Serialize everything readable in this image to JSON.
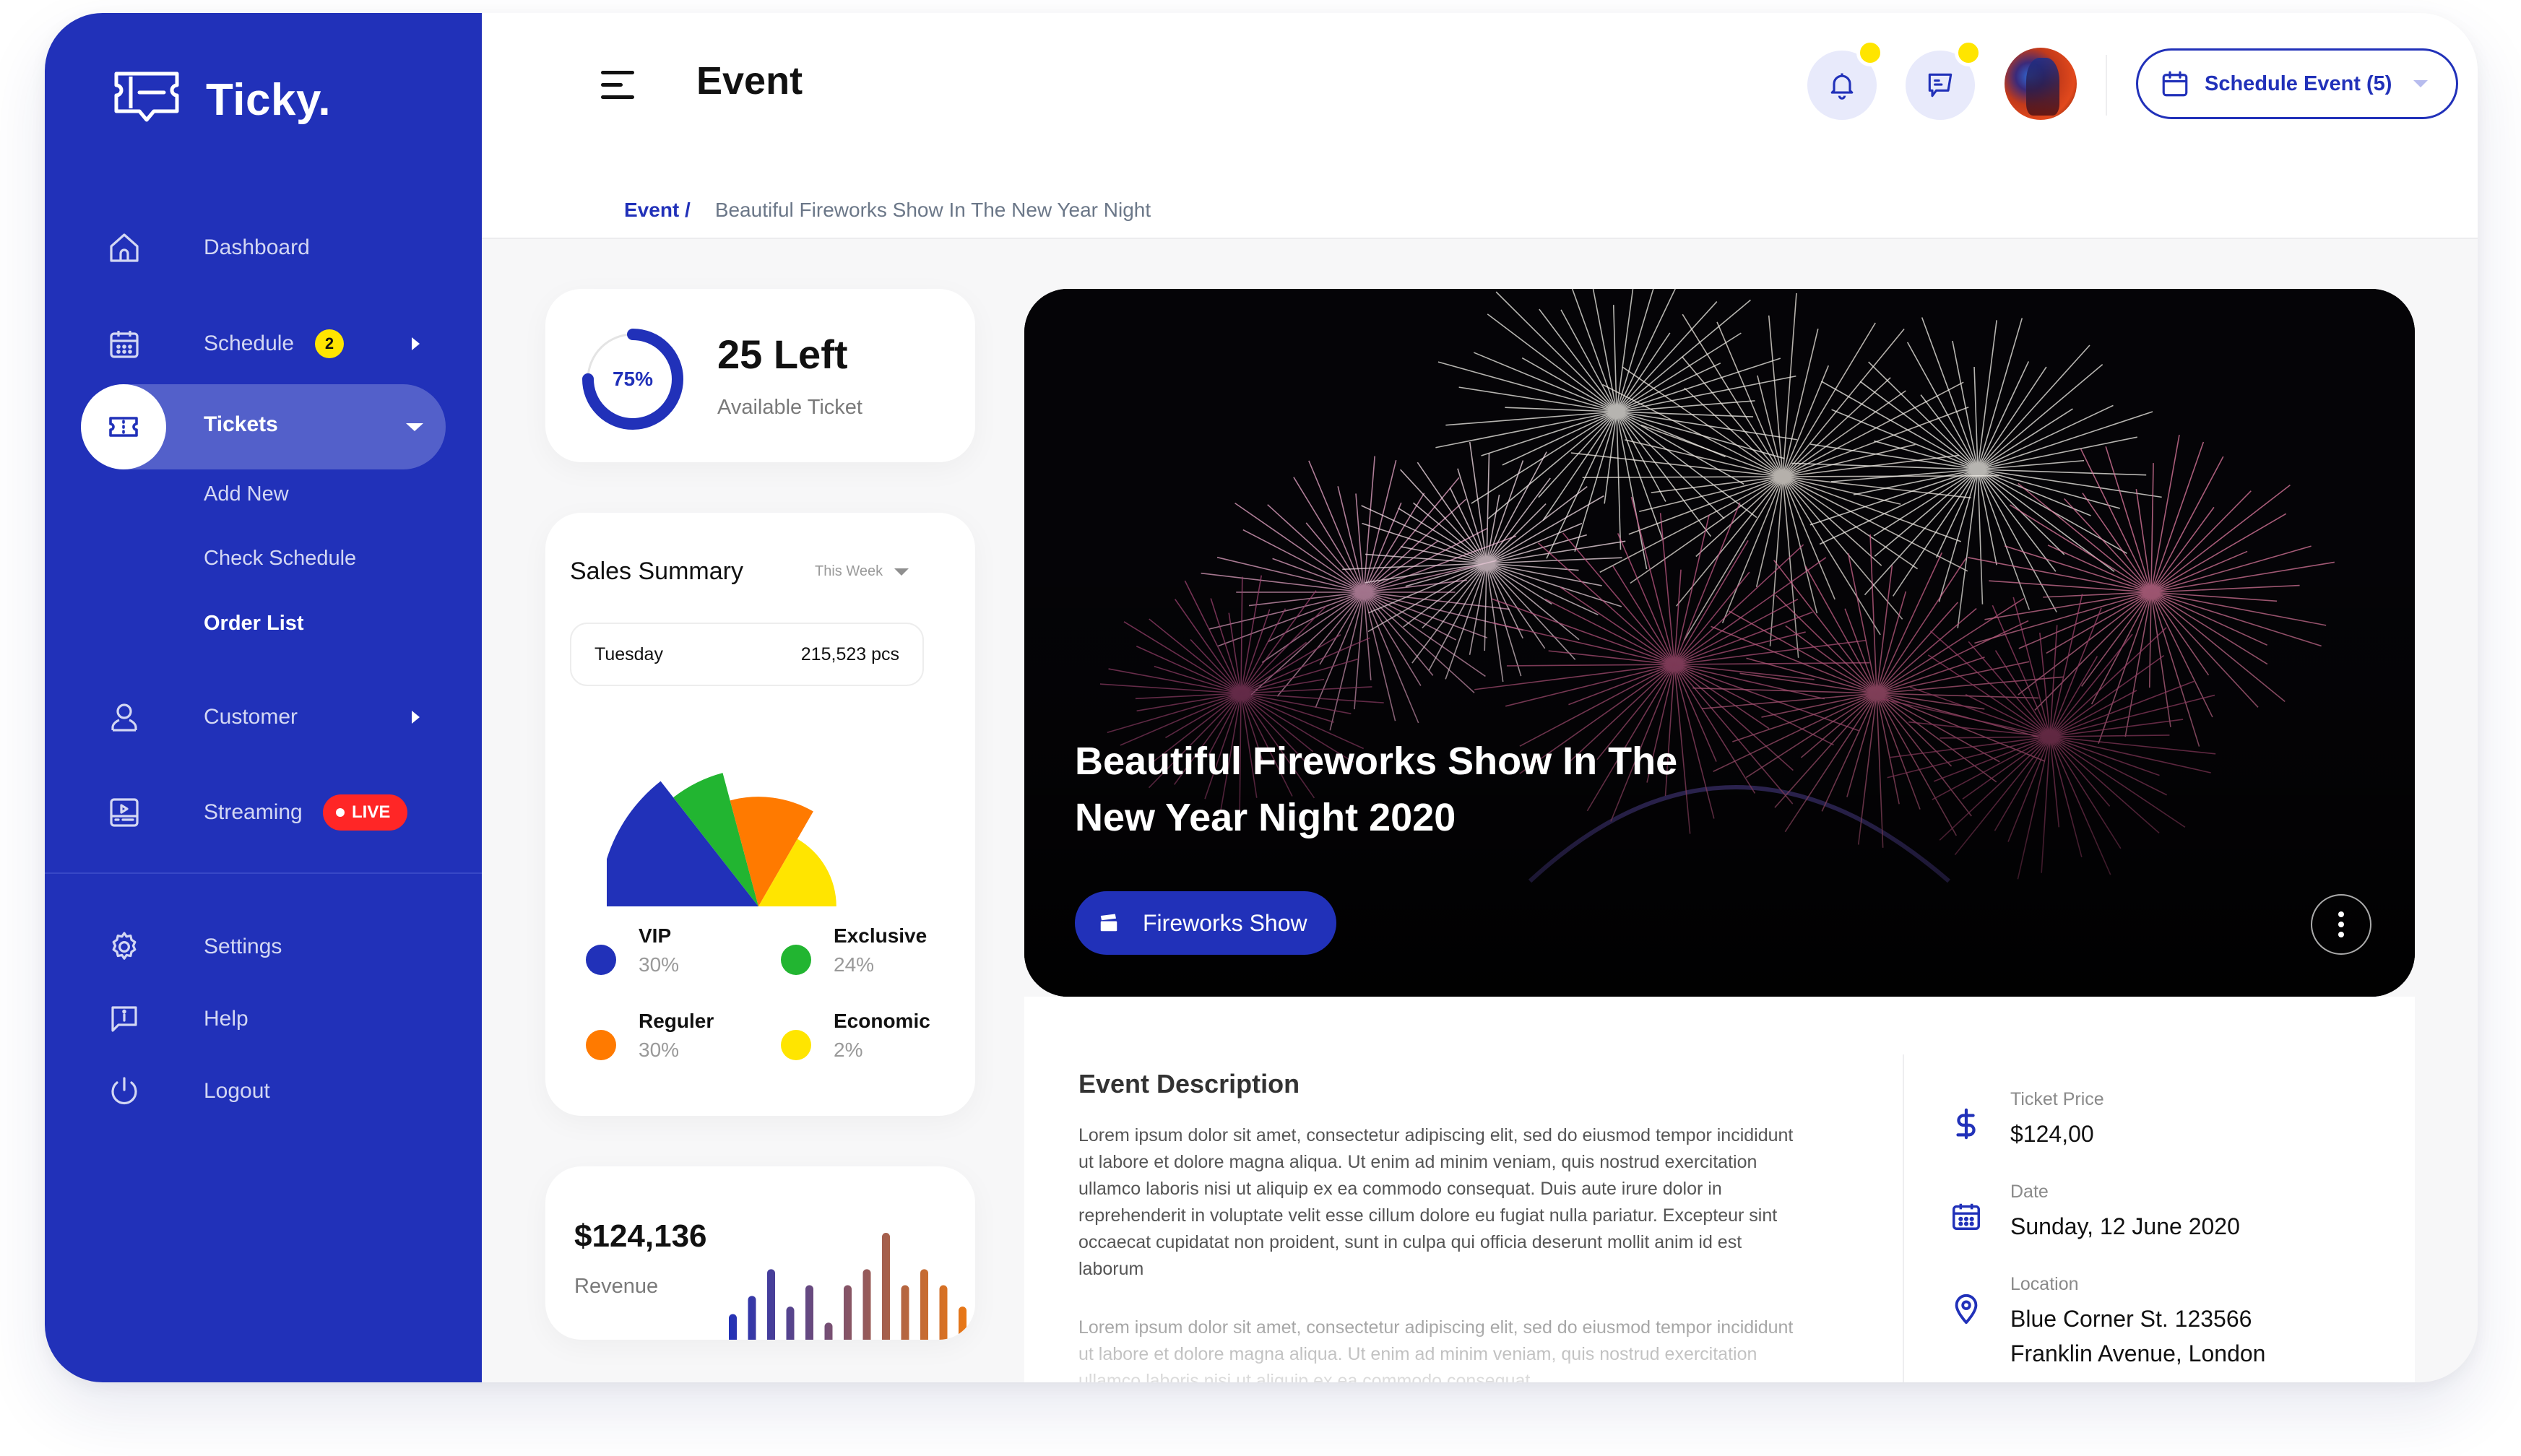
{
  "app": {
    "name": "Ticky."
  },
  "sidebar": {
    "items": [
      {
        "label": "Dashboard",
        "icon": "home-icon"
      },
      {
        "label": "Schedule",
        "icon": "calendar-icon",
        "badge": "2",
        "has_submenu": true
      },
      {
        "label": "Tickets",
        "icon": "ticket-icon",
        "active": true,
        "expanded": true,
        "children": [
          {
            "label": "Add New"
          },
          {
            "label": "Check Schedule"
          },
          {
            "label": "Order List",
            "active": true
          }
        ]
      },
      {
        "label": "Customer",
        "icon": "user-icon",
        "has_submenu": true
      },
      {
        "label": "Streaming",
        "icon": "video-icon",
        "badge": "LIVE"
      }
    ],
    "bottom_items": [
      {
        "label": "Settings",
        "icon": "gear-icon"
      },
      {
        "label": "Help",
        "icon": "help-icon"
      },
      {
        "label": "Logout",
        "icon": "power-icon"
      }
    ]
  },
  "header": {
    "title": "Event",
    "breadcrumb": {
      "root": "Event /",
      "current": "Beautiful Fireworks Show In The New Year Night"
    },
    "schedule_button": "Schedule Event (5)",
    "notifications_indicator": true,
    "messages_indicator": true
  },
  "tickets": {
    "percent": 75,
    "percent_label": "75%",
    "value": "25 Left",
    "label": "Available Ticket"
  },
  "sales_summary": {
    "title": "Sales Summary",
    "filter": "This Week",
    "row": {
      "day": "Tuesday",
      "value": "215,523 pcs"
    }
  },
  "revenue": {
    "value": "$124,136",
    "label": "Revenue"
  },
  "event": {
    "title": "Beautiful Fireworks Show In The New Year Night 2020",
    "category": "Fireworks Show",
    "description_title": "Event Description",
    "description_p1": "Lorem ipsum dolor sit amet, consectetur adipiscing elit, sed do eiusmod tempor incididunt ut labore et dolore magna aliqua. Ut enim ad minim veniam, quis nostrud exercitation ullamco laboris nisi ut aliquip ex ea commodo consequat. Duis aute irure dolor in reprehenderit in voluptate velit esse cillum dolore eu fugiat nulla pariatur. Excepteur sint occaecat cupidatat non proident, sunt in culpa qui officia deserunt mollit anim id est laborum",
    "description_p2": "Lorem ipsum dolor sit amet, consectetur adipiscing elit, sed do eiusmod tempor incididunt ut labore et dolore magna aliqua. Ut enim ad minim veniam, quis nostrud exercitation ullamco laboris nisi ut aliquip ex ea commodo consequat.",
    "info": [
      {
        "label": "Ticket Price",
        "value": "$124,00",
        "icon": "dollar-icon"
      },
      {
        "label": "Date",
        "value": "Sunday, 12 June 2020",
        "icon": "calendar-icon"
      },
      {
        "label": "Location",
        "value": "Blue Corner St. 123566\nFranklin Avenue, London",
        "value_line1": "Blue Corner St. 123566",
        "value_line2": "Franklin Avenue, London",
        "icon": "location-pin-icon"
      }
    ]
  },
  "colors": {
    "primary": "#2131B9",
    "vip": "#2131B9",
    "exclusive": "#22B531",
    "reguler": "#FF7A00",
    "economic": "#FFE500",
    "live": "#FF2626",
    "badge": "#FFE500"
  },
  "chart_data": [
    {
      "type": "pie",
      "subtype": "polar-area-half",
      "title": "Sales Summary",
      "categories": [
        "VIP",
        "Exclusive",
        "Reguler",
        "Economic"
      ],
      "values": [
        30,
        24,
        30,
        2
      ],
      "value_labels": [
        "30%",
        "24%",
        "30%",
        "2%"
      ],
      "relative_radius": [
        1.0,
        0.87,
        0.69,
        0.49
      ],
      "colors": [
        "#2131B9",
        "#22B531",
        "#FF7A00",
        "#FFE500"
      ],
      "legend": "bottom"
    },
    {
      "type": "bar",
      "title": "Revenue",
      "categories": [
        "1",
        "2",
        "3",
        "4",
        "5",
        "6",
        "7",
        "8",
        "9",
        "10",
        "11",
        "12",
        "13"
      ],
      "values": [
        24,
        41,
        66,
        31,
        51,
        16,
        51,
        66,
        100,
        51,
        66,
        51,
        31
      ],
      "ylim": [
        0,
        100
      ],
      "gradient": [
        "#2131B9",
        "#F07A10"
      ],
      "grid": false
    }
  ]
}
